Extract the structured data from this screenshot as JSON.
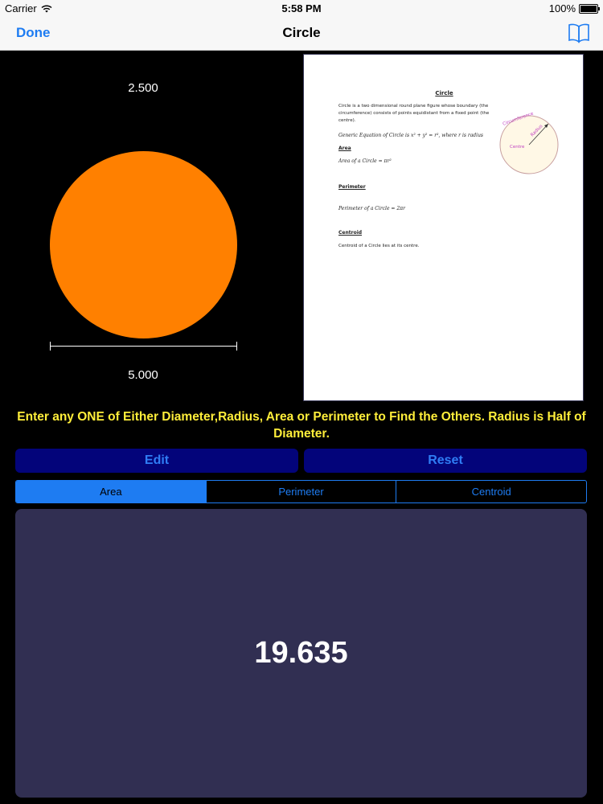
{
  "status_bar": {
    "carrier": "Carrier",
    "time": "5:58 PM",
    "battery": "100%"
  },
  "nav": {
    "done_label": "Done",
    "title": "Circle",
    "book_icon": "book-icon"
  },
  "shape": {
    "radius_value": "2.500",
    "diameter_value": "5.000",
    "fill_color": "#ff8000"
  },
  "document": {
    "title": "Circle",
    "intro": "Circle is a two dimensional round plane figure whose boundary (the circumference) consists of points equidistant from a fixed point (the centre).",
    "generic_equation": "Generic Equation of Circle is x² + y² = r², where r is radius",
    "area_heading": "Area",
    "area_formula": "Area of a Circle = πr²",
    "perimeter_heading": "Perimeter",
    "perimeter_formula": "Perimeter of a Circle = 2πr",
    "centroid_heading": "Centroid",
    "centroid_text": "Centroid of a Circle lies at its centre.",
    "figure_labels": {
      "circumference": "Circumference",
      "radius": "Radius",
      "centre": "Centre"
    }
  },
  "instructions": "Enter any ONE of Either Diameter,Radius, Area or Perimeter to Find the Others. Radius is Half of Diameter.",
  "buttons": {
    "edit_label": "Edit",
    "reset_label": "Reset"
  },
  "tabs": [
    {
      "label": "Area",
      "active": true
    },
    {
      "label": "Perimeter",
      "active": false
    },
    {
      "label": "Centroid",
      "active": false
    }
  ],
  "result": {
    "value": "19.635"
  },
  "colors": {
    "accent": "#1e7cf2",
    "instruction_text": "#ffee3a",
    "button_bg": "#03047a",
    "result_bg": "#312f52"
  }
}
